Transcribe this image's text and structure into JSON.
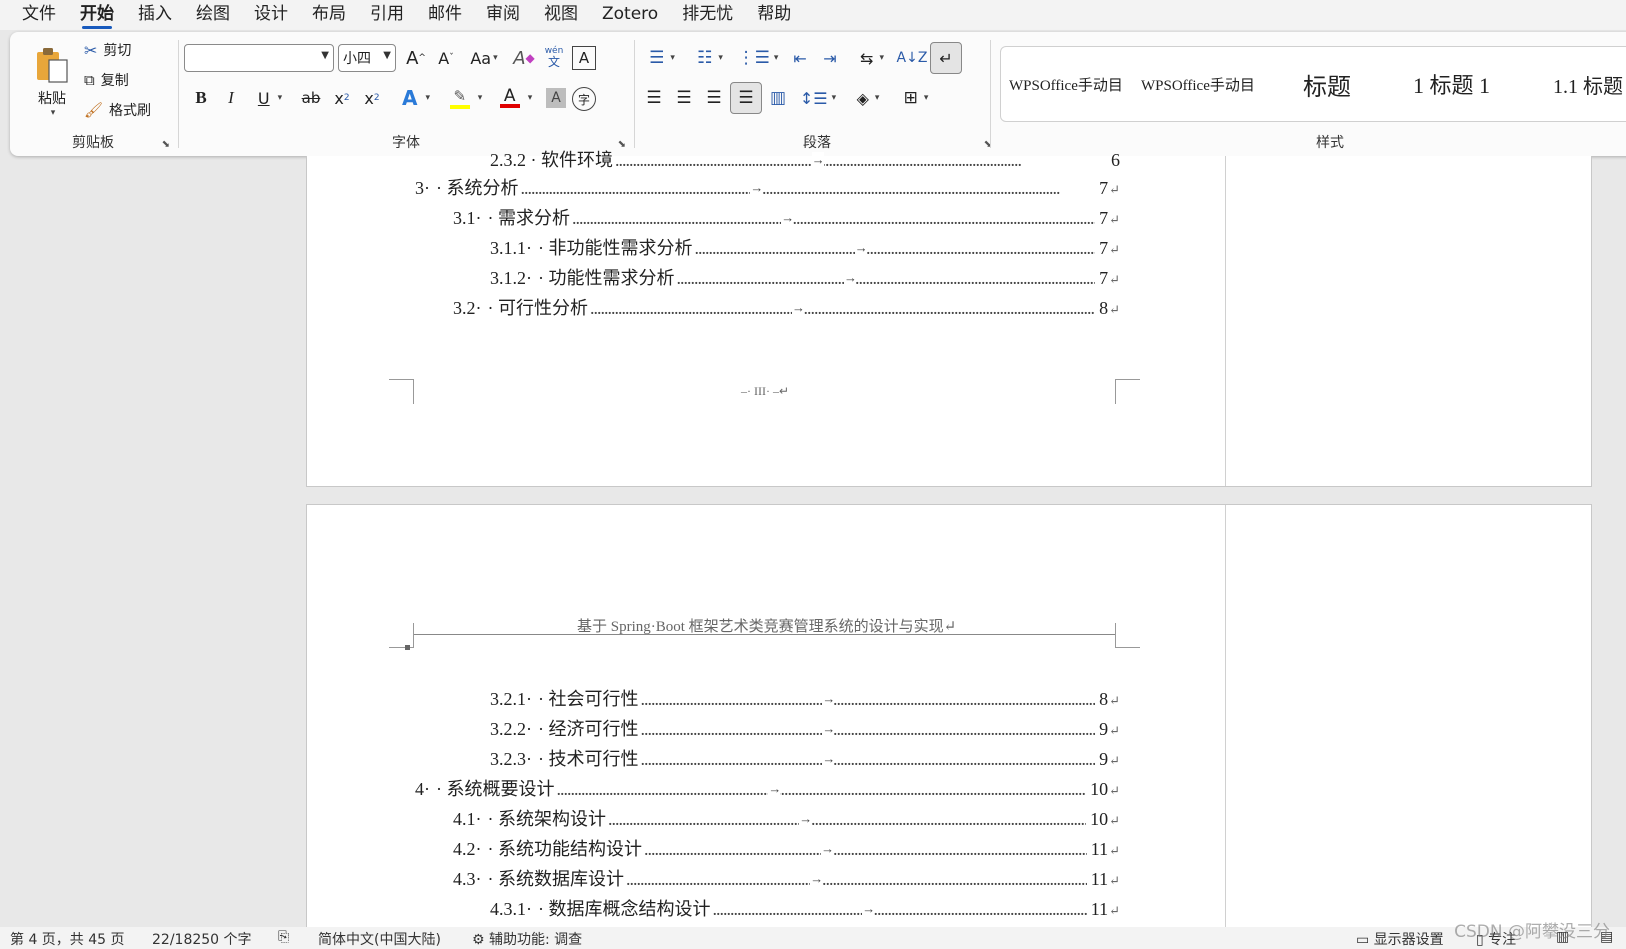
{
  "menu": {
    "items": [
      "文件",
      "开始",
      "插入",
      "绘图",
      "设计",
      "布局",
      "引用",
      "邮件",
      "审阅",
      "视图",
      "Zotero",
      "排无忧",
      "帮助"
    ],
    "active": "开始"
  },
  "ribbon": {
    "clipboard": {
      "label": "剪贴板",
      "paste": "粘贴",
      "cut": "剪切",
      "copy": "复制",
      "format_painter": "格式刷"
    },
    "font": {
      "label": "字体",
      "font_name": "",
      "font_size": "小四",
      "phonetic_top": "wén",
      "phonetic_bottom": "文",
      "bold": "B",
      "italic": "I",
      "underline": "U",
      "strike": "ab",
      "subscript": "x",
      "superscript": "x",
      "highlight_color": "#ffff00",
      "font_color": "#e00000",
      "enclosed_char": "字",
      "grow": "A",
      "shrink": "A",
      "change_case": "Aa",
      "char_border": "A",
      "char_shade": "A",
      "text_effects": "A",
      "clear_format": "A"
    },
    "paragraph": {
      "label": "段落"
    },
    "styles": {
      "label": "样式",
      "items": [
        "WPSOffice手动目",
        "WPSOffice手动目",
        "标题",
        "1   标题 1",
        "1.1  标题 2"
      ]
    }
  },
  "document": {
    "page1": {
      "partial_line": "2.3.2 · 软件环境",
      "partial_page": "6",
      "toc": [
        {
          "num": "3·",
          "title": "· 系统分析",
          "page": "7",
          "level": 1
        },
        {
          "num": "3.1·",
          "title": "· 需求分析",
          "page": "7",
          "level": 2
        },
        {
          "num": "3.1.1·",
          "title": "· 非功能性需求分析",
          "page": "7",
          "level": 3
        },
        {
          "num": "3.1.2·",
          "title": "· 功能性需求分析",
          "page": "7",
          "level": 3
        },
        {
          "num": "3.2·",
          "title": "· 可行性分析",
          "page": "8",
          "level": 2
        }
      ],
      "footer": "–· III· –↵"
    },
    "page2": {
      "header": "基于 Spring·Boot 框架艺术类竞赛管理系统的设计与实现↵",
      "toc": [
        {
          "num": "3.2.1·",
          "title": "· 社会可行性",
          "page": "8",
          "level": 3
        },
        {
          "num": "3.2.2·",
          "title": "· 经济可行性",
          "page": "9",
          "level": 3
        },
        {
          "num": "3.2.3·",
          "title": "· 技术可行性",
          "page": "9",
          "level": 3
        },
        {
          "num": "4·",
          "title": "· 系统概要设计",
          "page": "10",
          "level": 1
        },
        {
          "num": "4.1·",
          "title": "· 系统架构设计",
          "page": "10",
          "level": 2
        },
        {
          "num": "4.2·",
          "title": "· 系统功能结构设计",
          "page": "11",
          "level": 2
        },
        {
          "num": "4.3·",
          "title": "· 系统数据库设计",
          "page": "11",
          "level": 2
        },
        {
          "num": "4.3.1·",
          "title": "· 数据库概念结构设计",
          "page": "11",
          "level": 3
        }
      ]
    },
    "return_mark": "↵",
    "tab_mark": "→"
  },
  "status": {
    "page": "第 4 页，共 45 页",
    "words": "22/18250 个字",
    "language": "简体中文(中国大陆)",
    "accessibility": "辅助功能: 调查",
    "display_settings": "显示器设置",
    "focus": "专注"
  },
  "watermark": "CSDN @阿攀没三分"
}
